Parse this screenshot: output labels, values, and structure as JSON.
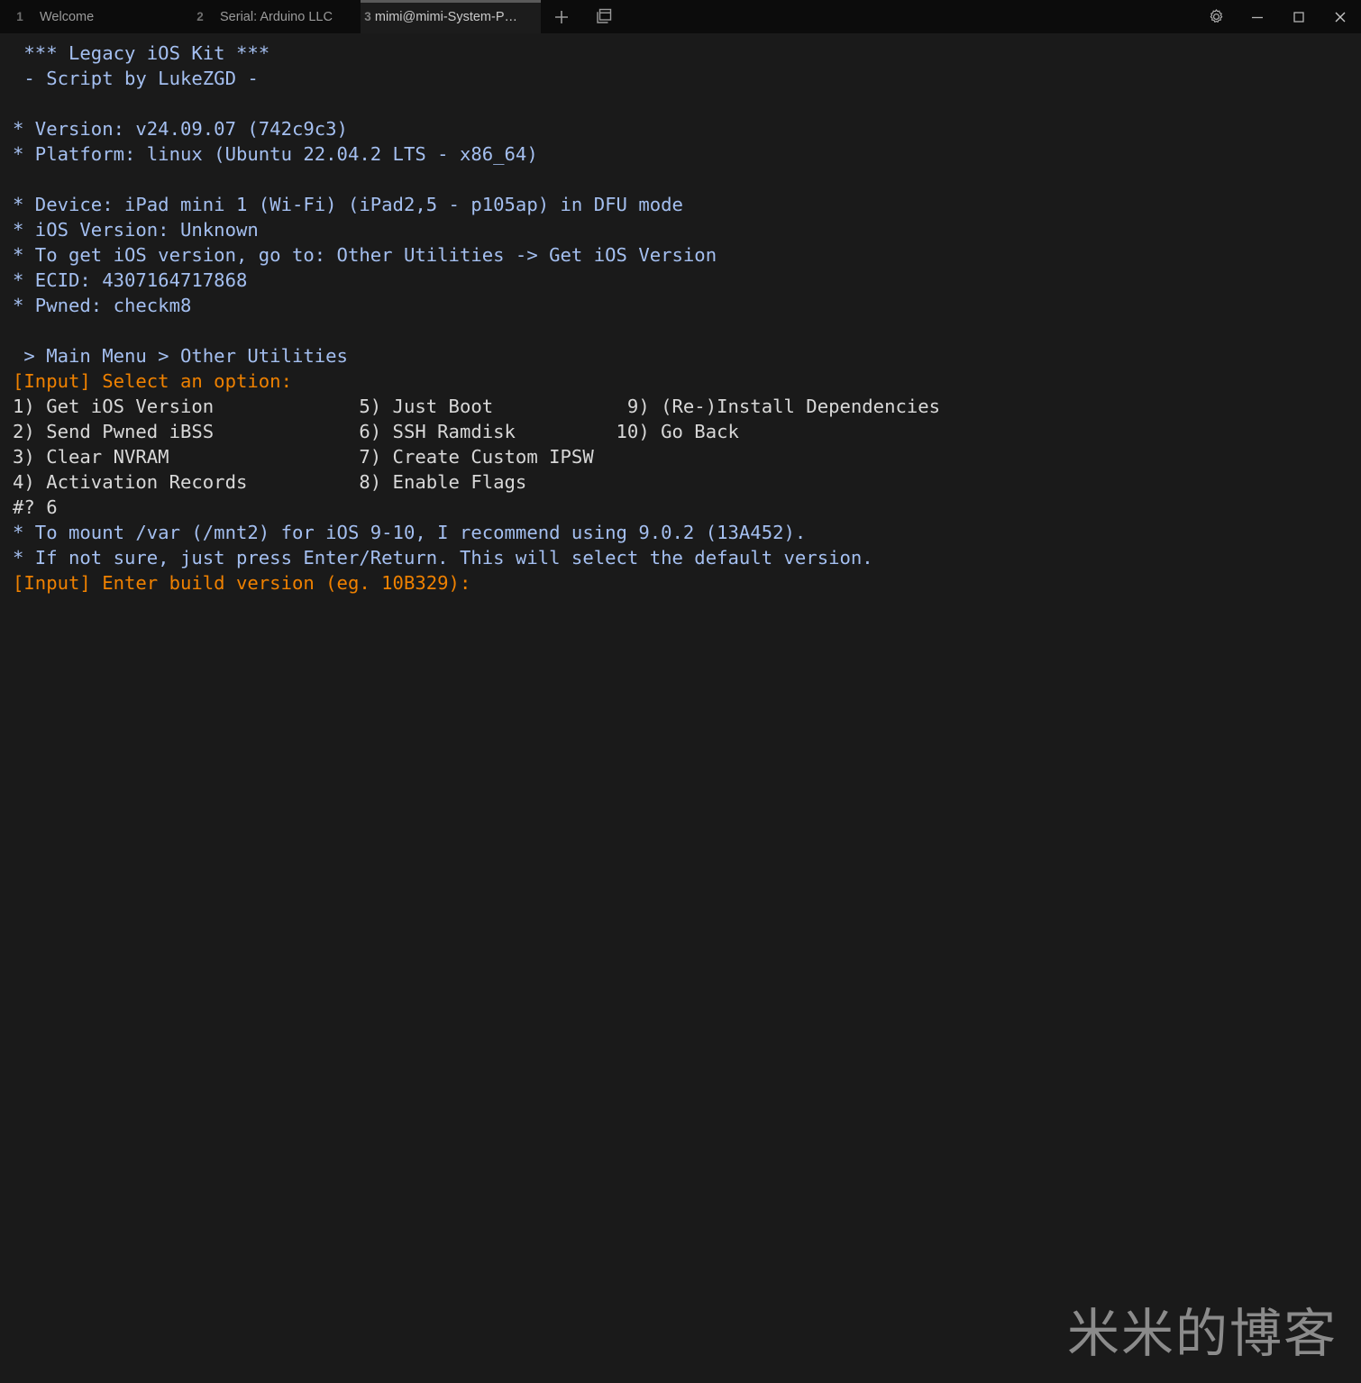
{
  "window": {
    "tabs": [
      {
        "number": "1",
        "label": "Welcome",
        "active": false
      },
      {
        "number": "2",
        "label": "Serial: Arduino LLC",
        "active": false
      },
      {
        "number": "3",
        "label": "mimi@mimi-System-P…",
        "active": true
      }
    ],
    "new_tab_label": "+",
    "split_pane_icon": "split-pane-icon",
    "settings_icon": "gear-icon",
    "minimize_icon": "minimize-icon",
    "maximize_icon": "maximize-icon",
    "close_icon": "close-icon",
    "colors": {
      "tabbar_bg": "#0c0c0c",
      "active_tab_bg": "#1c1c1c",
      "active_tab_indicator": "#5a5a5a",
      "terminal_bg": "#1a1a1a",
      "info_blue": "#a4bff0",
      "prompt_orange": "#ef8100",
      "default_text": "#d6d6d6"
    }
  },
  "terminal": {
    "lines": [
      {
        "text": " *** Legacy iOS Kit ***",
        "color": "blue"
      },
      {
        "text": " - Script by LukeZGD -",
        "color": "blue"
      },
      {
        "text": "",
        "color": "plain"
      },
      {
        "text": "* Version: v24.09.07 (742c9c3)",
        "color": "blue"
      },
      {
        "text": "* Platform: linux (Ubuntu 22.04.2 LTS - x86_64)",
        "color": "blue"
      },
      {
        "text": "",
        "color": "plain"
      },
      {
        "text": "* Device: iPad mini 1 (Wi-Fi) (iPad2,5 - p105ap) in DFU mode",
        "color": "blue"
      },
      {
        "text": "* iOS Version: Unknown",
        "color": "blue"
      },
      {
        "text": "* To get iOS version, go to: Other Utilities -> Get iOS Version",
        "color": "blue"
      },
      {
        "text": "* ECID: 4307164717868",
        "color": "blue"
      },
      {
        "text": "* Pwned: checkm8",
        "color": "blue"
      },
      {
        "text": "",
        "color": "plain"
      },
      {
        "text": " > Main Menu > Other Utilities",
        "color": "blue"
      },
      {
        "text": "[Input] Select an option:",
        "color": "orange"
      },
      {
        "text": "1) Get iOS Version             5) Just Boot            9) (Re-)Install Dependencies",
        "color": "plain"
      },
      {
        "text": "2) Send Pwned iBSS             6) SSH Ramdisk         10) Go Back",
        "color": "plain"
      },
      {
        "text": "3) Clear NVRAM                 7) Create Custom IPSW",
        "color": "plain"
      },
      {
        "text": "4) Activation Records          8) Enable Flags",
        "color": "plain"
      },
      {
        "text": "#? 6",
        "color": "plain"
      },
      {
        "text": "* To mount /var (/mnt2) for iOS 9-10, I recommend using 9.0.2 (13A452).",
        "color": "blue"
      },
      {
        "text": "* If not sure, just press Enter/Return. This will select the default version.",
        "color": "blue"
      },
      {
        "text": "[Input] Enter build version (eg. 10B329):",
        "color": "orange"
      }
    ],
    "menu": {
      "breadcrumb": " > Main Menu > Other Utilities",
      "prompt": "[Input] Select an option:",
      "options": [
        {
          "key": "1",
          "label": "Get iOS Version"
        },
        {
          "key": "2",
          "label": "Send Pwned iBSS"
        },
        {
          "key": "3",
          "label": "Clear NVRAM"
        },
        {
          "key": "4",
          "label": "Activation Records"
        },
        {
          "key": "5",
          "label": "Just Boot"
        },
        {
          "key": "6",
          "label": "SSH Ramdisk"
        },
        {
          "key": "7",
          "label": "Create Custom IPSW"
        },
        {
          "key": "8",
          "label": "Enable Flags"
        },
        {
          "key": "9",
          "label": "(Re-)Install Dependencies"
        },
        {
          "key": "10",
          "label": "Go Back"
        }
      ],
      "selection_echo": "#? 6",
      "build_prompt": "[Input] Enter build version (eg. 10B329):"
    },
    "info": {
      "title": " *** Legacy iOS Kit ***",
      "author": " - Script by LukeZGD -",
      "version": "* Version: v24.09.07 (742c9c3)",
      "platform": "* Platform: linux (Ubuntu 22.04.2 LTS - x86_64)",
      "device": "* Device: iPad mini 1 (Wi-Fi) (iPad2,5 - p105ap) in DFU mode",
      "ios_version": "* iOS Version: Unknown",
      "hint": "* To get iOS version, go to: Other Utilities -> Get iOS Version",
      "ecid": "* ECID: 4307164717868",
      "pwned": "* Pwned: checkm8",
      "mount_note": "* To mount /var (/mnt2) for iOS 9-10, I recommend using 9.0.2 (13A452).",
      "default_note": "* If not sure, just press Enter/Return. This will select the default version."
    }
  },
  "watermark": {
    "text": "米米的博客"
  }
}
